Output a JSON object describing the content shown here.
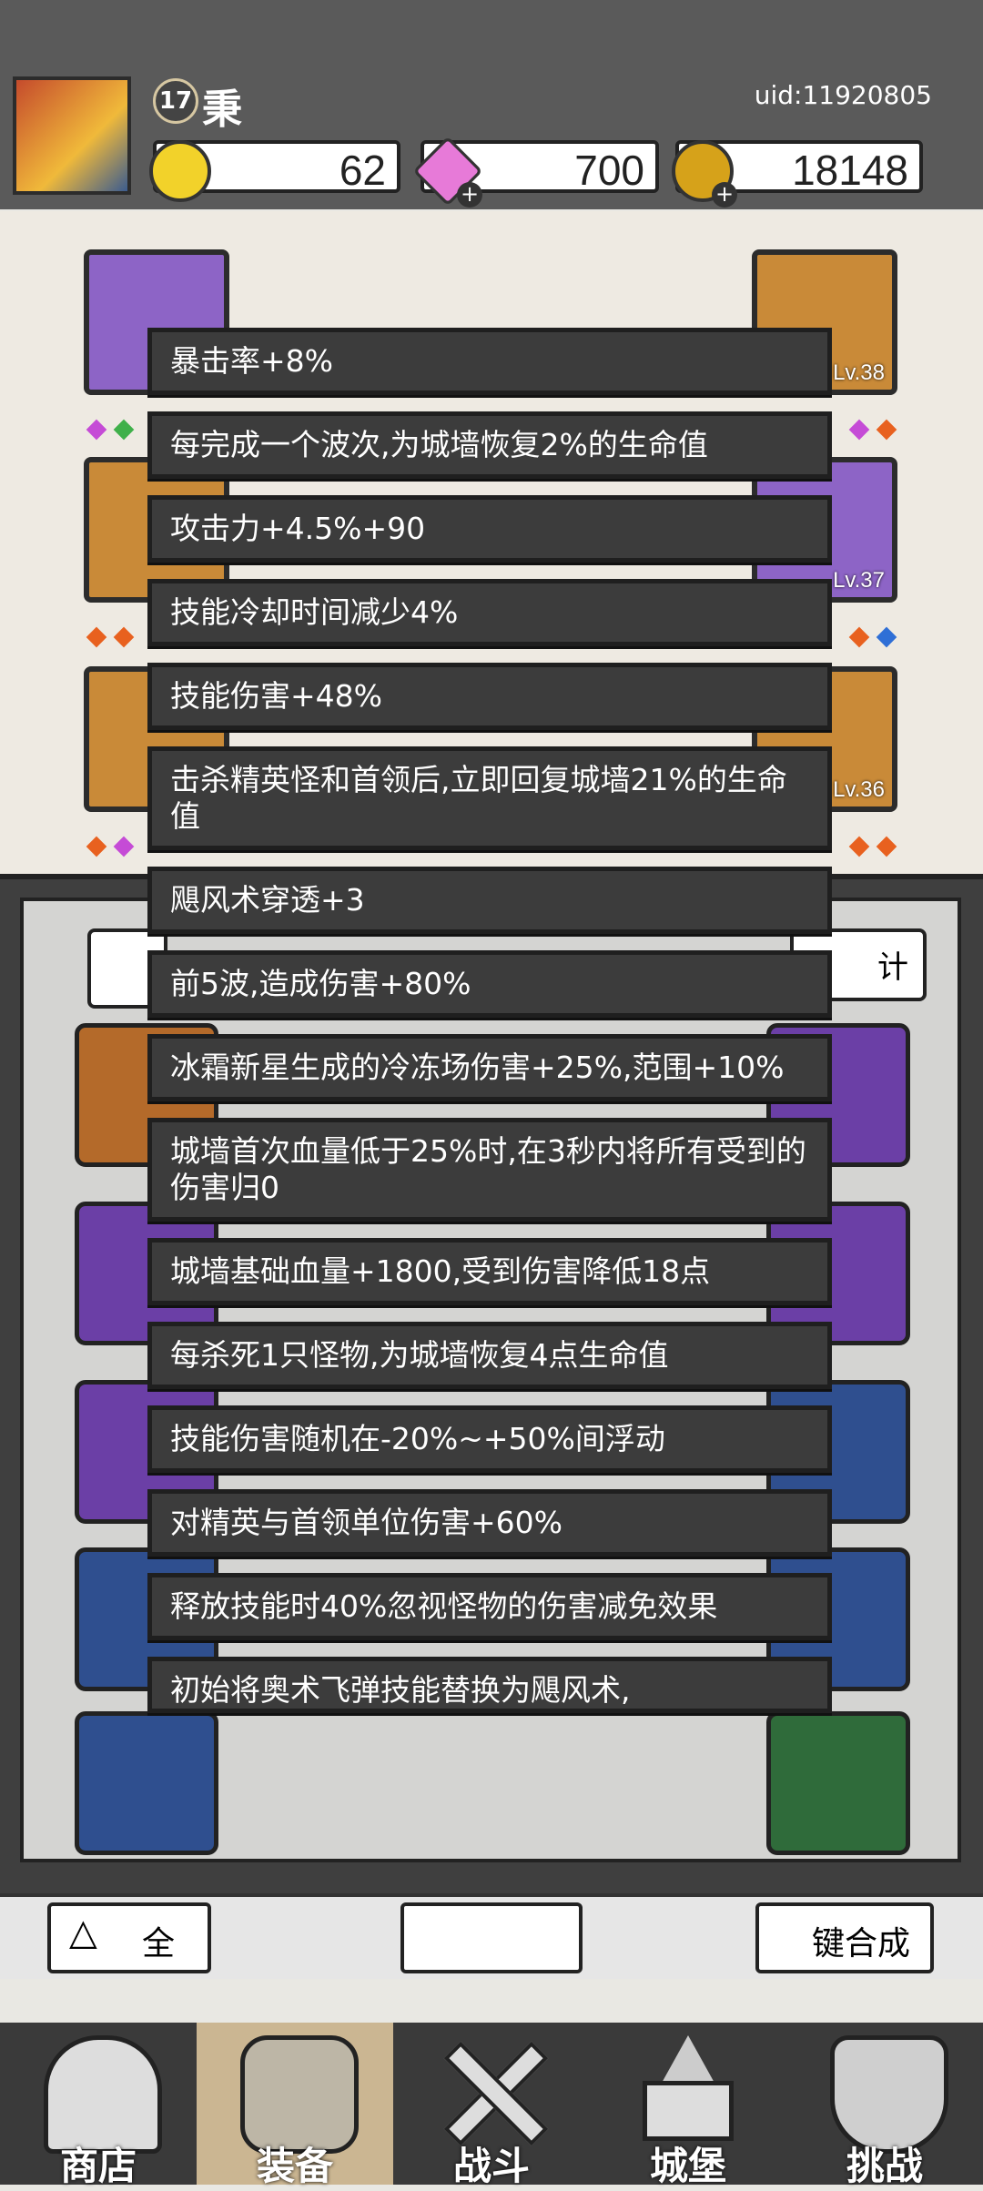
{
  "header": {
    "level": "17",
    "name": "秉",
    "uid": "uid:11920805",
    "currencies": [
      {
        "icon": "yellow-gem-icon",
        "value": "62"
      },
      {
        "icon": "diamond-icon",
        "value": "700"
      },
      {
        "icon": "gold-coin-icon",
        "value": "18148"
      }
    ]
  },
  "equipment": {
    "levels": [
      "Lv.38",
      "Lv.37",
      "Lv.36"
    ]
  },
  "tooltip_lines": [
    "暴击率+8%",
    "每完成一个波次,为城墙恢复2%的生命值",
    "攻击力+4.5%+90",
    "技能冷却时间减少4%",
    "技能伤害+48%",
    "击杀精英怪和首领后,立即回复城墙21%的生命值",
    "飓风术穿透+3",
    "前5波,造成伤害+80%",
    "冰霜新星生成的冷冻场伤害+25%,范围+10%",
    "城墙首次血量低于25%时,在3秒内将所有受到的伤害归0",
    "城墙基础血量+1800,受到伤害降低18点",
    "每杀死1只怪物,为城墙恢复4点生命值",
    "技能伤害随机在-20%~+50%间浮动",
    "对精英与首领单位伤害+60%",
    "释放技能时40%忽视怪物的伤害减免效果",
    "初始将奥术飞弹技能替换为飓风术,"
  ],
  "panel": {
    "stats_button": "计",
    "merge_button": "键合成",
    "sort_button": "全"
  },
  "nav": [
    {
      "label": "商店",
      "icon": "shop-icon"
    },
    {
      "label": "装备",
      "icon": "backpack-icon"
    },
    {
      "label": "战斗",
      "icon": "crossed-swords-icon"
    },
    {
      "label": "城堡",
      "icon": "castle-icon"
    },
    {
      "label": "挑战",
      "icon": "challenge-shield-icon"
    }
  ],
  "colors": {
    "tooltip_bg": "#3c3c3c",
    "active_nav": "#cbb692"
  }
}
